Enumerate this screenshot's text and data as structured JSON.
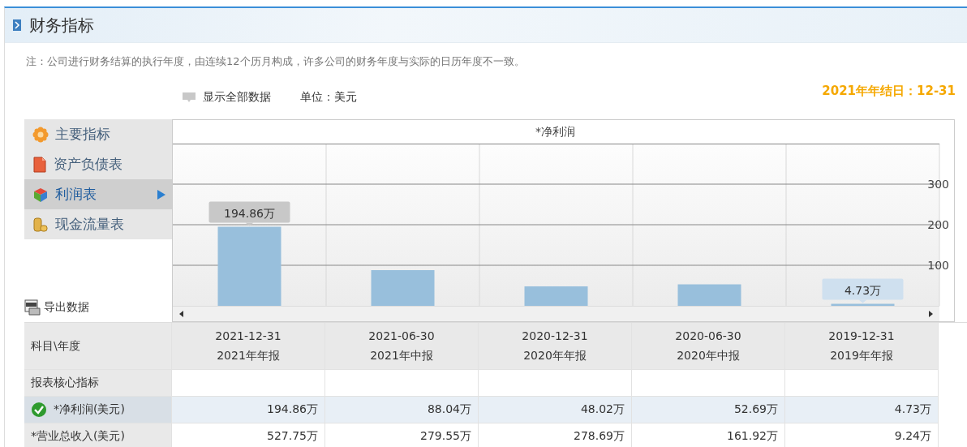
{
  "header": {
    "title": "财务指标"
  },
  "note": "注：公司进行财务结算的执行年度，由连续12个历月构成，许多公司的财务年度与实际的日历年度不一致。",
  "toolbar": {
    "show_all": "显示全部数据",
    "unit": "单位：美元",
    "year_end": "2021年年结日：12-31"
  },
  "sidebar": {
    "items": [
      {
        "label": "主要指标",
        "selected": false
      },
      {
        "label": "资产负债表",
        "selected": false
      },
      {
        "label": "利润表",
        "selected": true
      },
      {
        "label": "现金流量表",
        "selected": false
      }
    ]
  },
  "export": "导出数据",
  "chart": {
    "chart_data": {
      "type": "bar",
      "title": "*净利润",
      "values": [
        195,
        88,
        48,
        53,
        5
      ],
      "ylim": [
        0,
        400
      ],
      "yticks": [
        100,
        200,
        300
      ],
      "grid": true
    },
    "tooltips": [
      {
        "text": "194.86万",
        "selected": false
      },
      {
        "text": "4.73万",
        "selected": true
      }
    ]
  },
  "table": {
    "corner": "科目\\年度",
    "columns": [
      {
        "date": "2021-12-31",
        "report": "2021年年报"
      },
      {
        "date": "2021-06-30",
        "report": "2021年中报"
      },
      {
        "date": "2020-12-31",
        "report": "2020年年报"
      },
      {
        "date": "2020-06-30",
        "report": "2020年中报"
      },
      {
        "date": "2019-12-31",
        "report": "2019年年报"
      }
    ],
    "rows": [
      {
        "kind": "section",
        "label": "报表核心指标"
      },
      {
        "kind": "data",
        "label": "*净利润(美元)",
        "selected": true,
        "cells": [
          "194.86万",
          "88.04万",
          "48.02万",
          "52.69万",
          "4.73万"
        ]
      },
      {
        "kind": "data",
        "label": "*营业总收入(美元)",
        "selected": false,
        "cells": [
          "527.75万",
          "279.55万",
          "278.69万",
          "161.92万",
          "9.24万"
        ]
      }
    ]
  }
}
